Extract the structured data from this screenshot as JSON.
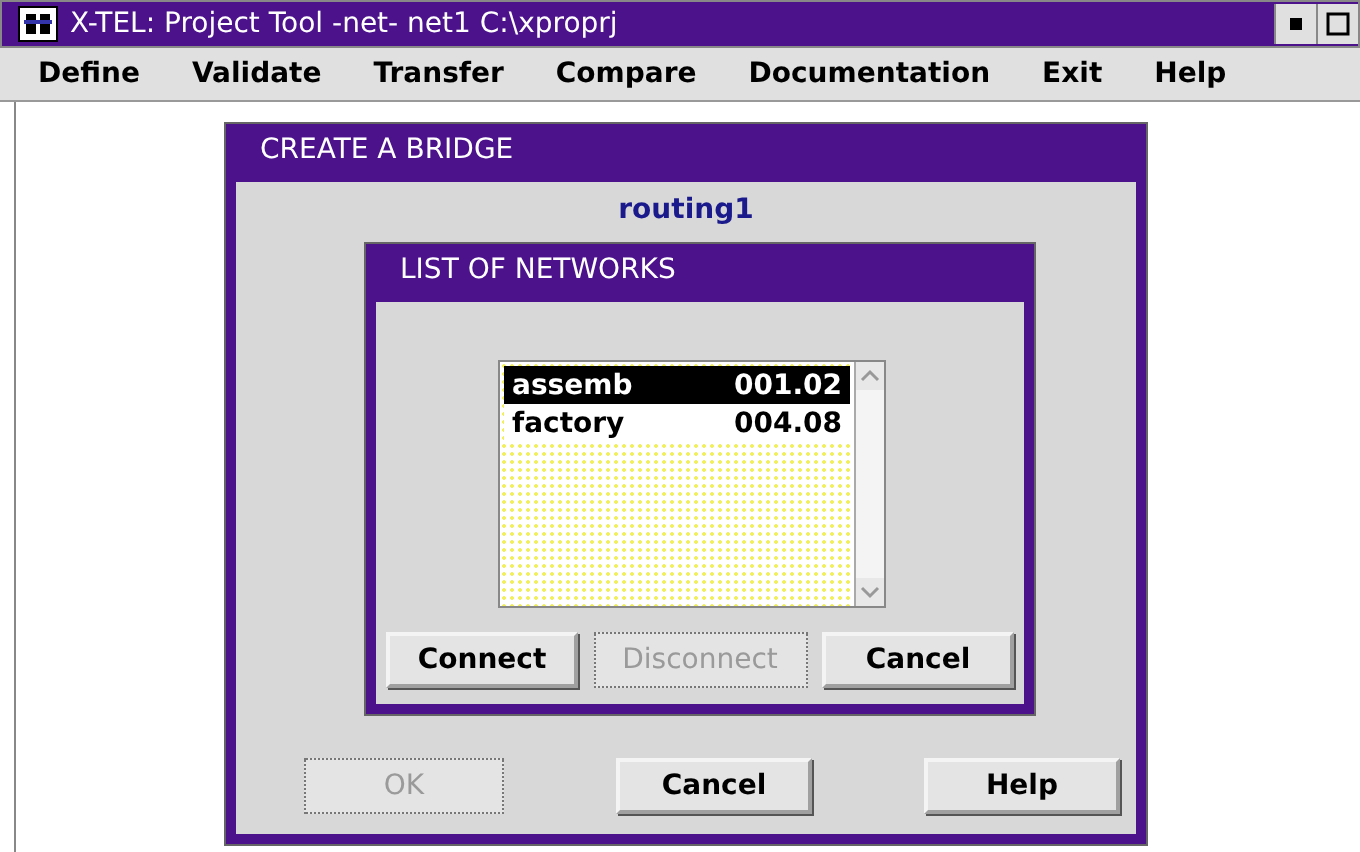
{
  "window": {
    "title": "X-TEL: Project Tool -net- net1 C:\\xproprj"
  },
  "menu": [
    {
      "label": "Define",
      "selected": false
    },
    {
      "label": "Validate",
      "selected": false
    },
    {
      "label": "Transfer",
      "selected": false
    },
    {
      "label": "Compare",
      "selected": false
    },
    {
      "label": "Documentation",
      "selected": false
    },
    {
      "label": "Exit",
      "selected": false
    },
    {
      "label": "Help",
      "selected": false
    }
  ],
  "bridge_dialog": {
    "title": "CREATE A BRIDGE",
    "subtitle": "routing1",
    "buttons": [
      {
        "label": "OK",
        "disabled": true
      },
      {
        "label": "Cancel",
        "disabled": false
      },
      {
        "label": "Help",
        "disabled": false
      }
    ]
  },
  "networks_dialog": {
    "title": "LIST OF NETWORKS",
    "items": [
      {
        "name": "assemb",
        "value": "001.02",
        "selected": true
      },
      {
        "name": "factory",
        "value": "004.08",
        "selected": false
      }
    ],
    "buttons": [
      {
        "label": "Connect",
        "disabled": false
      },
      {
        "label": "Disconnect",
        "disabled": true
      },
      {
        "label": "Cancel",
        "disabled": false
      }
    ]
  }
}
